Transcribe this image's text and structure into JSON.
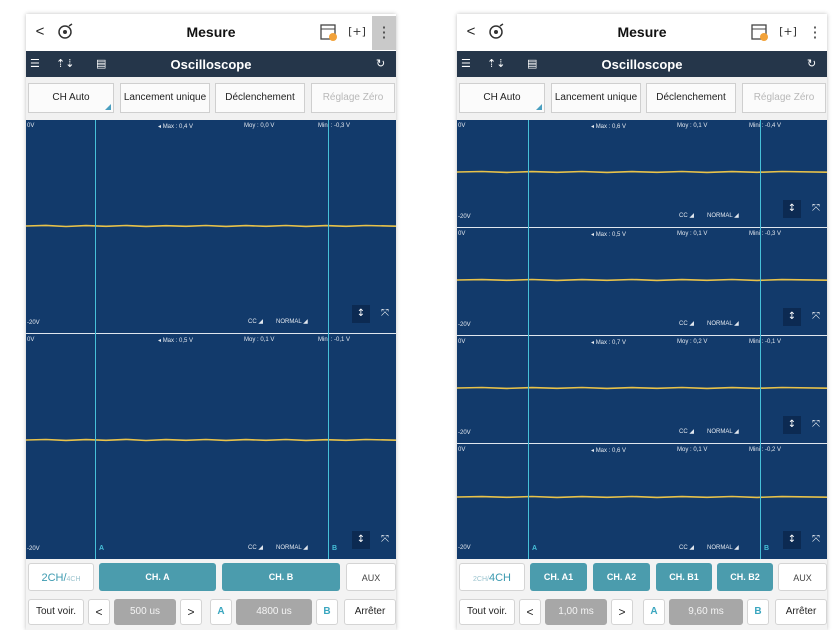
{
  "left": {
    "header": {
      "title": "Mesure",
      "back": "<",
      "menu": "⋮"
    },
    "subheader": {
      "title": "Oscilloscope"
    },
    "toolbar": {
      "btn1": "CH Auto",
      "btn2": "Lancement unique",
      "btn3": "Déclenchement",
      "btn4": "Réglage Zéro"
    },
    "channels": [
      {
        "top_v": "0V",
        "bottom_v": "-20V",
        "max": "Max : 0,4 V",
        "moy": "Moy : 0,0 V",
        "mini": "Mini : -0,3 V",
        "coupling": "CC",
        "mode": "NORMAL"
      },
      {
        "top_v": "0V",
        "bottom_v": "-20V",
        "max": "Max : 0,5 V",
        "moy": "Moy : 0,1 V",
        "mini": "Mini : -0,1 V",
        "coupling": "CC",
        "mode": "NORMAL"
      }
    ],
    "cursor_a": "A",
    "cursor_b": "B",
    "chrow": {
      "mode_big": "2CH",
      "mode_sep": "/",
      "mode_small": "4CH",
      "ch1": "CH. A",
      "ch2": "CH. B",
      "aux": "AUX"
    },
    "bottom": {
      "tout": "Tout voir.",
      "prev": "<",
      "time": "500 us",
      "next": ">",
      "a": "A",
      "delta": "4800 us",
      "b": "B",
      "stop": "Arrêter"
    }
  },
  "right": {
    "header": {
      "title": "Mesure",
      "back": "<",
      "menu": "⋮"
    },
    "subheader": {
      "title": "Oscilloscope"
    },
    "toolbar": {
      "btn1": "CH Auto",
      "btn2": "Lancement unique",
      "btn3": "Déclenchement",
      "btn4": "Réglage Zéro"
    },
    "channels": [
      {
        "top_v": "0V",
        "bottom_v": "-20V",
        "max": "Max : 0,6 V",
        "moy": "Moy : 0,1 V",
        "mini": "Mini : -0,4 V",
        "coupling": "CC",
        "mode": "NORMAL"
      },
      {
        "top_v": "0V",
        "bottom_v": "-20V",
        "max": "Max : 0,5 V",
        "moy": "Moy : 0,1 V",
        "mini": "Mini : -0,3 V",
        "coupling": "CC",
        "mode": "NORMAL"
      },
      {
        "top_v": "0V",
        "bottom_v": "-20V",
        "max": "Max : 0,7 V",
        "moy": "Moy : 0,2 V",
        "mini": "Mini : -0,1 V",
        "coupling": "CC",
        "mode": "NORMAL"
      },
      {
        "top_v": "0V",
        "bottom_v": "-20V",
        "max": "Max : 0,6 V",
        "moy": "Moy : 0,1 V",
        "mini": "Mini : -0,2 V",
        "coupling": "CC",
        "mode": "NORMAL"
      }
    ],
    "cursor_a": "A",
    "cursor_b": "B",
    "chrow": {
      "mode_small": "2CH",
      "mode_sep": "/",
      "mode_big": "4CH",
      "ch1": "CH. A1",
      "ch2": "CH. A2",
      "ch3": "CH. B1",
      "ch4": "CH. B2",
      "aux": "AUX"
    },
    "bottom": {
      "tout": "Tout voir.",
      "prev": "<",
      "time": "1,00 ms",
      "next": ">",
      "a": "A",
      "delta": "9,60 ms",
      "b": "B",
      "stop": "Arrêter"
    }
  },
  "colors": {
    "scope_bg": "#123a6b",
    "trace": "#e8c24a",
    "cursor": "#46c0d9",
    "channel_btn": "#4b9cad",
    "topbar_dark": "#25364a"
  },
  "icons": [
    "back-arrow-icon",
    "logo-icon",
    "calendar-icon",
    "fullscreen-icon",
    "more-vert-icon",
    "settings-sliders-icon",
    "trigger-icon",
    "save-icon",
    "refresh-icon",
    "expand-vertical-icon",
    "zoom-fit-icon"
  ]
}
